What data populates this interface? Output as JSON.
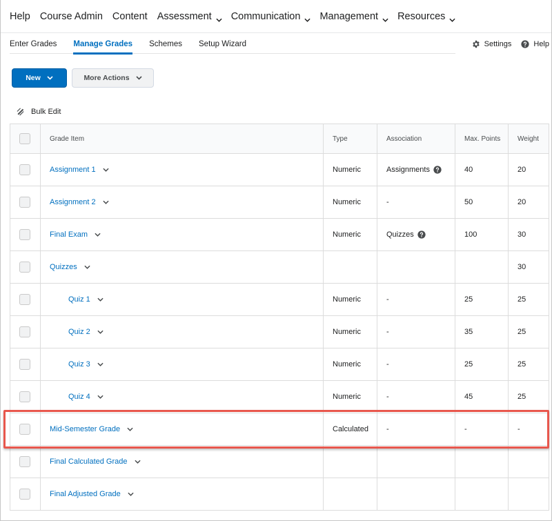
{
  "topnav": {
    "items": [
      {
        "label": "Help",
        "dropdown": false
      },
      {
        "label": "Course Admin",
        "dropdown": false
      },
      {
        "label": "Content",
        "dropdown": false
      },
      {
        "label": "Assessment",
        "dropdown": true
      },
      {
        "label": "Communication",
        "dropdown": true
      },
      {
        "label": "Management",
        "dropdown": true
      },
      {
        "label": "Resources",
        "dropdown": true
      }
    ]
  },
  "subnav": {
    "tabs": [
      {
        "label": "Enter Grades",
        "active": false
      },
      {
        "label": "Manage Grades",
        "active": true
      },
      {
        "label": "Schemes",
        "active": false
      },
      {
        "label": "Setup Wizard",
        "active": false
      }
    ],
    "settings_label": "Settings",
    "help_label": "Help"
  },
  "toolbar": {
    "new_label": "New",
    "more_actions_label": "More Actions",
    "bulk_edit_label": "Bulk Edit"
  },
  "table": {
    "headers": {
      "grade_item": "Grade Item",
      "type": "Type",
      "association": "Association",
      "max_points": "Max. Points",
      "weight": "Weight"
    },
    "rows": [
      {
        "name": "Assignment 1",
        "indent": false,
        "type": "Numeric",
        "association": "Assignments",
        "assoc_help": true,
        "max_points": "40",
        "weight": "20"
      },
      {
        "name": "Assignment 2",
        "indent": false,
        "type": "Numeric",
        "association": "-",
        "assoc_help": false,
        "max_points": "50",
        "weight": "20"
      },
      {
        "name": "Final Exam",
        "indent": false,
        "type": "Numeric",
        "association": "Quizzes",
        "assoc_help": true,
        "max_points": "100",
        "weight": "30"
      },
      {
        "name": "Quizzes",
        "indent": false,
        "type": "",
        "association": "",
        "assoc_help": false,
        "max_points": "",
        "weight": "30"
      },
      {
        "name": "Quiz 1",
        "indent": true,
        "type": "Numeric",
        "association": "-",
        "assoc_help": false,
        "max_points": "25",
        "weight": "25"
      },
      {
        "name": "Quiz 2",
        "indent": true,
        "type": "Numeric",
        "association": "-",
        "assoc_help": false,
        "max_points": "35",
        "weight": "25"
      },
      {
        "name": "Quiz 3",
        "indent": true,
        "type": "Numeric",
        "association": "-",
        "assoc_help": false,
        "max_points": "25",
        "weight": "25"
      },
      {
        "name": "Quiz 4",
        "indent": true,
        "type": "Numeric",
        "association": "-",
        "assoc_help": false,
        "max_points": "45",
        "weight": "25"
      },
      {
        "name": "Mid-Semester Grade",
        "indent": false,
        "type": "Calculated",
        "association": "-",
        "assoc_help": false,
        "max_points": "-",
        "weight": "-"
      },
      {
        "name": "Final Calculated Grade",
        "indent": false,
        "type": "",
        "association": "",
        "assoc_help": false,
        "max_points": "",
        "weight": ""
      },
      {
        "name": "Final Adjusted Grade",
        "indent": false,
        "type": "",
        "association": "",
        "assoc_help": false,
        "max_points": "",
        "weight": ""
      }
    ]
  },
  "highlight": {
    "row_name": "Mid-Semester Grade",
    "color": "#e8574d"
  },
  "colors": {
    "accent": "#006fbf",
    "link": "#006fbf"
  }
}
